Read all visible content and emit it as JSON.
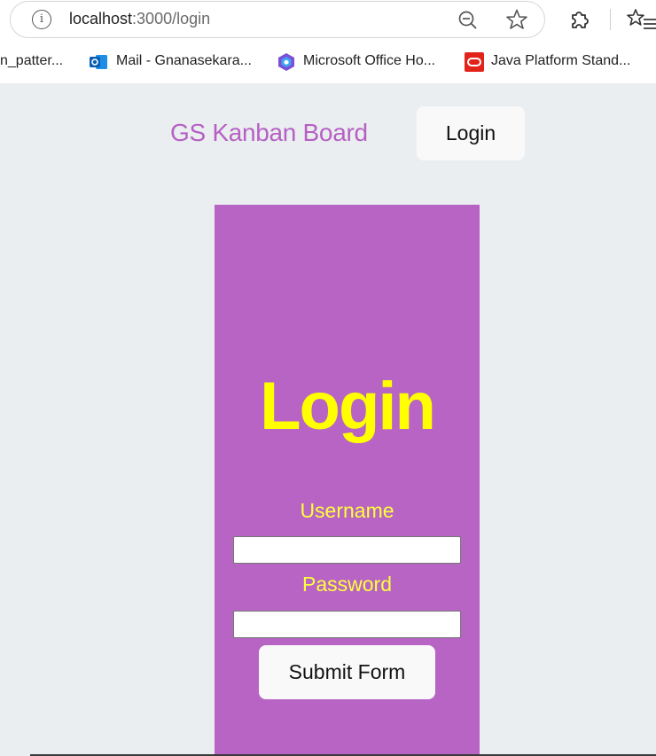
{
  "browser": {
    "url_host": "localhost",
    "url_path": ":3000/login",
    "info_icon": "info-icon",
    "bookmarks": [
      {
        "label": "n_patter...",
        "icon": "none"
      },
      {
        "label": "Mail - Gnanasekara...",
        "icon": "outlook-icon"
      },
      {
        "label": "Microsoft Office Ho...",
        "icon": "office-icon"
      },
      {
        "label": "Java Platform Stand...",
        "icon": "oracle-icon"
      }
    ]
  },
  "header": {
    "brand": "GS Kanban Board",
    "login_button": "Login"
  },
  "form": {
    "title": "Login",
    "username_label": "Username",
    "username_value": "",
    "password_label": "Password",
    "password_value": "",
    "submit_label": "Submit Form"
  },
  "colors": {
    "page_bg": "#ebeef0",
    "card_bg": "#b764c4",
    "brand": "#b561c3",
    "title": "#ffff00"
  }
}
